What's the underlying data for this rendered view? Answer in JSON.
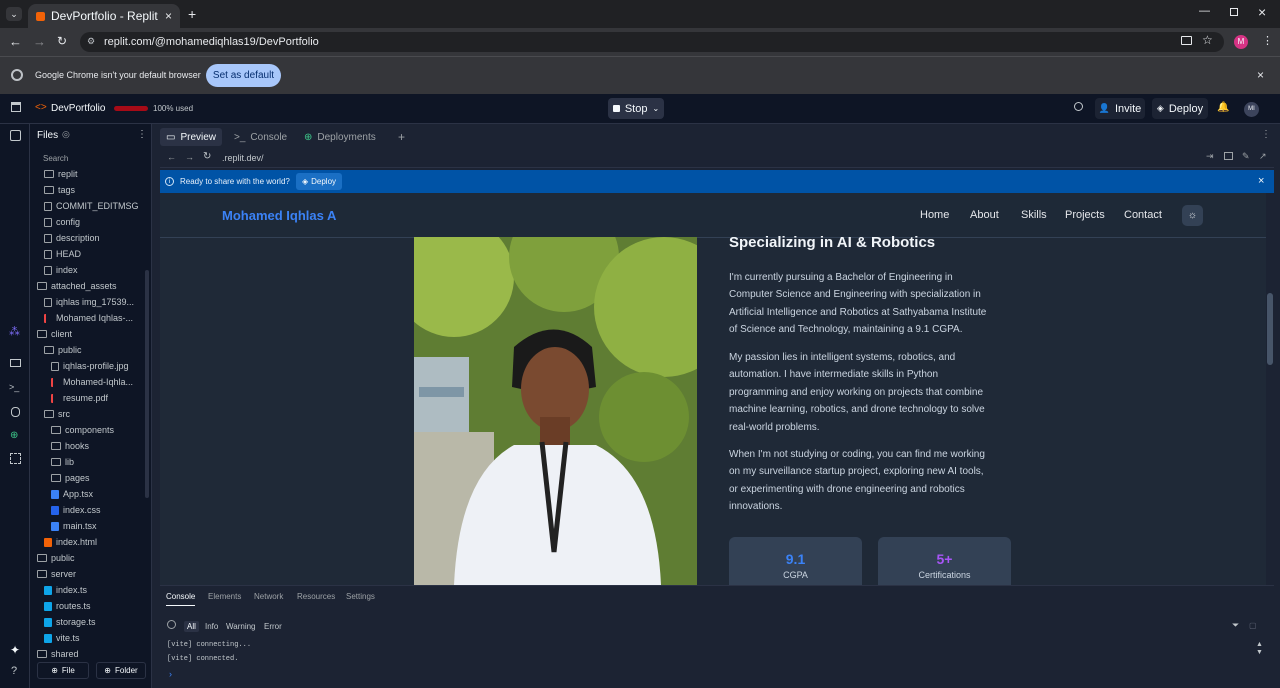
{
  "browser": {
    "tab_title": "DevPortfolio - Replit",
    "url": "replit.com/@mohamediqhlas19/DevPortfolio",
    "infobar_text": "Google Chrome isn't your default browser",
    "set_default": "Set as default",
    "profile_initial": "M"
  },
  "replit": {
    "project": "DevPortfolio",
    "usage": "100% used",
    "stop": "Stop",
    "invite": "Invite",
    "deploy": "Deploy",
    "avatar": "MI"
  },
  "files": {
    "title": "Files",
    "search": "Search",
    "new_file": "File",
    "new_folder": "Folder",
    "items": [
      {
        "name": "replit",
        "kind": "folder",
        "level": 2
      },
      {
        "name": "tags",
        "kind": "folder",
        "level": 2
      },
      {
        "name": "COMMIT_EDITMSG",
        "kind": "file",
        "level": 2
      },
      {
        "name": "config",
        "kind": "file",
        "level": 2
      },
      {
        "name": "description",
        "kind": "file",
        "level": 2
      },
      {
        "name": "HEAD",
        "kind": "file",
        "level": 2
      },
      {
        "name": "index",
        "kind": "file",
        "level": 2
      },
      {
        "name": "attached_assets",
        "kind": "folder",
        "level": 1
      },
      {
        "name": "iqhlas img_17539...",
        "kind": "image",
        "level": 2
      },
      {
        "name": "Mohamed Iqhlas-...",
        "kind": "pdf",
        "level": 2
      },
      {
        "name": "client",
        "kind": "folder",
        "level": 1
      },
      {
        "name": "public",
        "kind": "folder",
        "level": 2
      },
      {
        "name": "iqhlas-profile.jpg",
        "kind": "image",
        "level": 3
      },
      {
        "name": "Mohamed-Iqhla...",
        "kind": "pdf",
        "level": 3
      },
      {
        "name": "resume.pdf",
        "kind": "pdf",
        "level": 3
      },
      {
        "name": "src",
        "kind": "folder",
        "level": 2
      },
      {
        "name": "components",
        "kind": "folder",
        "level": 3
      },
      {
        "name": "hooks",
        "kind": "folder",
        "level": 3
      },
      {
        "name": "lib",
        "kind": "folder",
        "level": 3
      },
      {
        "name": "pages",
        "kind": "folder",
        "level": 3
      },
      {
        "name": "App.tsx",
        "kind": "tsx",
        "level": 3
      },
      {
        "name": "index.css",
        "kind": "css",
        "level": 3
      },
      {
        "name": "main.tsx",
        "kind": "tsx",
        "level": 3
      },
      {
        "name": "index.html",
        "kind": "html",
        "level": 2
      },
      {
        "name": "public",
        "kind": "folder",
        "level": 1
      },
      {
        "name": "server",
        "kind": "folder",
        "level": 1
      },
      {
        "name": "index.ts",
        "kind": "ts",
        "level": 2
      },
      {
        "name": "routes.ts",
        "kind": "ts",
        "level": 2
      },
      {
        "name": "storage.ts",
        "kind": "ts",
        "level": 2
      },
      {
        "name": "vite.ts",
        "kind": "ts",
        "level": 2
      },
      {
        "name": "shared",
        "kind": "folder",
        "level": 1
      }
    ]
  },
  "panes": {
    "preview": "Preview",
    "console": "Console",
    "deployments": "Deployments",
    "url": ".replit.dev/"
  },
  "banner": {
    "text": "Ready to share with the world?",
    "deploy": "Deploy"
  },
  "site": {
    "brand": "Mohamed Iqhlas A",
    "nav": [
      "Home",
      "About",
      "Skills",
      "Projects",
      "Contact"
    ],
    "heading": "Specializing in AI & Robotics",
    "paragraphs": [
      [
        "I'm currently pursuing a Bachelor of Engineering in",
        "Computer Science and Engineering with specialization in",
        "Artificial Intelligence and Robotics at Sathyabama Institute",
        "of Science and Technology, maintaining a 9.1 CGPA."
      ],
      [
        "My passion lies in intelligent systems, robotics, and",
        "automation. I have intermediate skills in Python",
        "programming and enjoy working on projects that combine",
        "machine learning, robotics, and drone technology to solve",
        "real-world problems."
      ],
      [
        "When I'm not studying or coding, you can find me working",
        "on my surveillance startup project, exploring new AI tools,",
        "or experimenting with drone engineering and robotics",
        "innovations."
      ]
    ],
    "stats": [
      {
        "value": "9.1",
        "label": "CGPA",
        "color": "#3b82f6"
      },
      {
        "value": "5+",
        "label": "Certifications",
        "color": "#a855f7"
      }
    ]
  },
  "devtools": {
    "tabs": [
      "Console",
      "Elements",
      "Network",
      "Resources",
      "Settings"
    ],
    "levels": [
      "All",
      "Info",
      "Warning",
      "Error"
    ],
    "logs": [
      "[vite] connecting...",
      "[vite] connected."
    ]
  }
}
